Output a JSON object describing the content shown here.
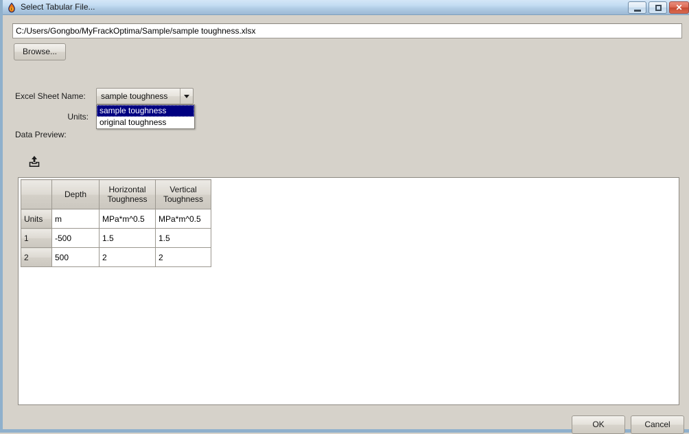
{
  "window": {
    "title": "Select Tabular File...",
    "app_icon": "flame-droplet-icon",
    "minimize_label": "",
    "maximize_label": "",
    "close_label": "✕"
  },
  "file": {
    "path_value": "C:/Users/Gongbo/MyFrackOptima/Sample/sample toughness.xlsx",
    "path_placeholder": "",
    "browse_label": "Browse..."
  },
  "form": {
    "sheet_label": "Excel Sheet Name:",
    "units_label": "Units:",
    "preview_label": "Data Preview:",
    "sheet_selected": "sample toughness",
    "sheet_options": [
      {
        "label": "sample toughness",
        "selected": true
      },
      {
        "label": "original toughness",
        "selected": false
      }
    ],
    "dropdown_arrow": "chevron-down-icon",
    "toolbar_icon": "upload-icon"
  },
  "table": {
    "corner_header": "",
    "columns": [
      "Depth",
      "Horizontal Toughness",
      "Vertical Toughness"
    ],
    "rows": [
      {
        "header": "Units",
        "cells": [
          "m",
          "MPa*m^0.5",
          "MPa*m^0.5"
        ]
      },
      {
        "header": "1",
        "cells": [
          "-500",
          "1.5",
          "1.5"
        ]
      },
      {
        "header": "2",
        "cells": [
          "500",
          "2",
          "2"
        ]
      }
    ]
  },
  "actions": {
    "ok_label": "OK",
    "cancel_label": "Cancel"
  },
  "colors": {
    "dialog_background": "#d6d2ca",
    "titlebar_top": "#d4e6f7",
    "titlebar_bottom": "#9cb9d4",
    "window_border": "#8fb0cc",
    "selection_blue": "#000080",
    "close_button_red": "#c64a34",
    "field_white": "#ffffff",
    "border_gray": "#9b978f"
  }
}
